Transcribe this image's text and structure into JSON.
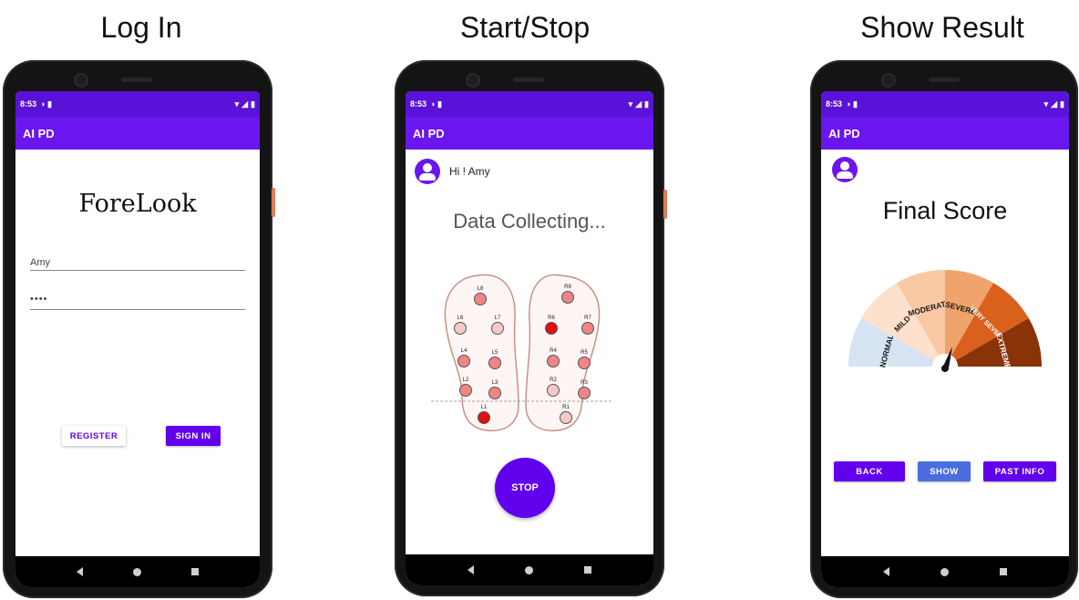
{
  "panels": [
    {
      "title": "Log In"
    },
    {
      "title": "Start/Stop"
    },
    {
      "title": "Show Result"
    }
  ],
  "status": {
    "time": "8:53"
  },
  "app_title": "AI PD",
  "login": {
    "logo": "ForeLook",
    "username_value": "Amy",
    "password_value": "••••",
    "register_label": "REGISTER",
    "signin_label": "SIGN IN"
  },
  "collect": {
    "greeting": "Hi ! Amy",
    "status_text": "Data Collecting...",
    "stop_label": "STOP",
    "sensors_left": [
      "L8",
      "L6",
      "L7",
      "L4",
      "L5",
      "L2",
      "L3",
      "L1"
    ],
    "sensors_right": [
      "R8",
      "R6",
      "R7",
      "R4",
      "R5",
      "R2",
      "R3",
      "R1"
    ]
  },
  "result": {
    "heading": "Final Score",
    "gauge_labels": [
      "NORMAL",
      "MILD",
      "MODERATE",
      "SEVERE",
      "VERY SEVERE",
      "EXTREME"
    ],
    "gauge_colors": [
      "#d6e3f3",
      "#fde1cc",
      "#f8c9a3",
      "#f0a36b",
      "#d9611d",
      "#8a3208"
    ],
    "back_label": "BACK",
    "show_label": "SHOW",
    "past_label": "PAST INFO"
  },
  "colors": {
    "primary": "#6200ee",
    "appbar": "#6a16ee",
    "statusbar": "#5a12d8",
    "sensor_active": "#e01010",
    "sensor_medium": "#f08585",
    "sensor_light": "#f8c8c8"
  }
}
